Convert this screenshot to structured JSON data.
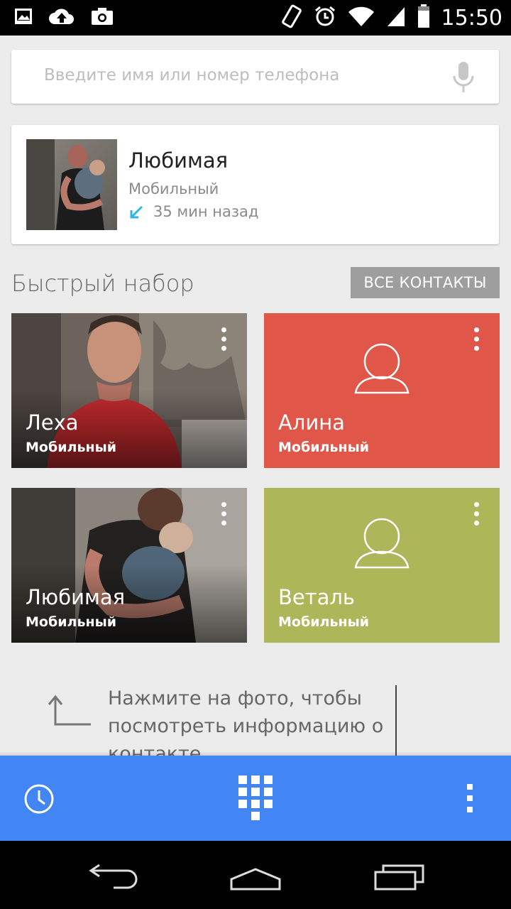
{
  "status_bar": {
    "time": "15:50",
    "left_icons": [
      "image-icon",
      "cloud-upload-icon",
      "camera-icon"
    ],
    "right_icons": [
      "vibrate-icon",
      "alarm-icon",
      "wifi-icon",
      "signal-icon",
      "battery-icon"
    ]
  },
  "search": {
    "placeholder": "Введите имя или номер телефона",
    "icon": "mic-icon"
  },
  "recent_call": {
    "name": "Любимая",
    "type": "Мобильный",
    "time": "35 мин назад",
    "call_direction_icon": "incoming-call-arrow-icon",
    "accent_color": "#33b5e5"
  },
  "speed_dial": {
    "title": "Быстрый набор",
    "all_contacts_label": "ВСЕ КОНТАКТЫ",
    "contacts": [
      {
        "name": "Леха",
        "type": "Мобильный",
        "photo": true,
        "color": "#6b5a55"
      },
      {
        "name": "Алина",
        "type": "Мобильный",
        "photo": false,
        "color": "#e0574a"
      },
      {
        "name": "Любимая",
        "type": "Мобильный",
        "photo": true,
        "color": "#5a5550"
      },
      {
        "name": "Веталь",
        "type": "Мобильный",
        "photo": false,
        "color": "#adb75a"
      }
    ]
  },
  "hint": {
    "text": "Нажмите на фото, чтобы посмотреть информацию о контакте"
  },
  "action_bar": {
    "color": "#4285f4",
    "buttons": [
      "history-icon",
      "dialpad-icon",
      "overflow-menu-icon"
    ]
  },
  "nav_bar": {
    "buttons": [
      "back-icon",
      "home-icon",
      "recents-icon"
    ]
  }
}
